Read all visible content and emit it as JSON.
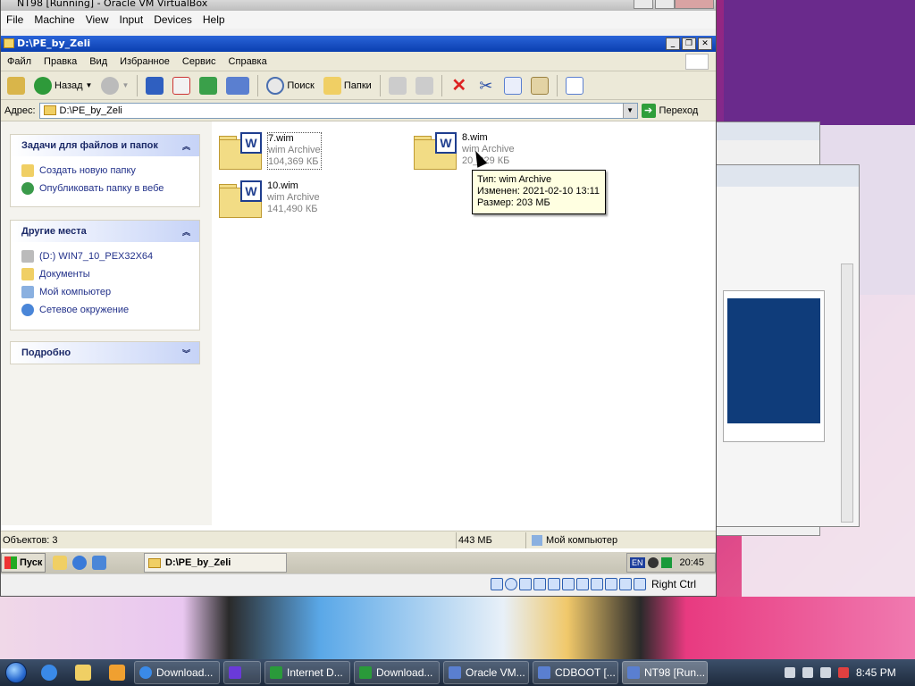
{
  "host": {
    "title": "NT98 [Running] - Oracle VM VirtualBox",
    "menu": [
      "File",
      "Machine",
      "View",
      "Input",
      "Devices",
      "Help"
    ],
    "host_key": "Right Ctrl"
  },
  "explorer": {
    "title": "D:\\PE_by_Zeli",
    "menu": [
      "Файл",
      "Правка",
      "Вид",
      "Избранное",
      "Сервис",
      "Справка"
    ],
    "toolbar": {
      "back": "Назад",
      "search": "Поиск",
      "folders": "Папки"
    },
    "address_label": "Адрес:",
    "address_value": "D:\\PE_by_Zeli",
    "go_label": "Переход"
  },
  "taskpane": {
    "tasks": {
      "title": "Задачи для файлов и папок",
      "items": [
        "Создать новую папку",
        "Опубликовать папку в вебе"
      ]
    },
    "places": {
      "title": "Другие места",
      "items": [
        "(D:) WIN7_10_PEX32X64",
        "Документы",
        "Мой компьютер",
        "Сетевое окружение"
      ]
    },
    "details": {
      "title": "Подробно"
    }
  },
  "files": [
    {
      "name": "7.wim",
      "type": "wim Archive",
      "size": "104,369 КБ"
    },
    {
      "name": "8.wim",
      "type": "wim Archive",
      "size": "20_329 КБ"
    },
    {
      "name": "10.wim",
      "type": "wim Archive",
      "size": "141,490 КБ"
    }
  ],
  "tooltip": {
    "type": "Тип: wim Archive",
    "modified": "Изменен: 2021-02-10 13:11",
    "size": "Размер: 203 МБ"
  },
  "statusbar": {
    "objects": "Объектов: 3",
    "size": "443 МБ",
    "location": "Мой компьютер"
  },
  "guest_taskbar": {
    "start": "Пуск",
    "task": "D:\\PE_by_Zeli",
    "lang": "EN",
    "clock": "20:45"
  },
  "win7_taskbar": {
    "buttons": [
      "Download...",
      "Internet D...",
      "Download...",
      "Oracle VM...",
      "CDBOOT [...",
      "NT98 [Run..."
    ],
    "clock": "8:45 PM"
  }
}
